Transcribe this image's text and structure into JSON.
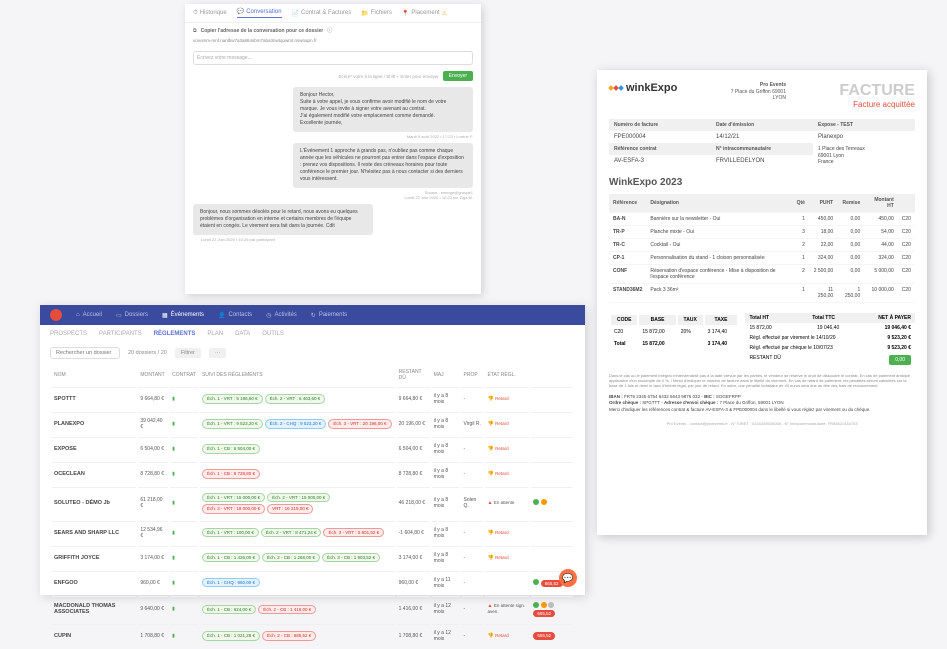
{
  "conversation": {
    "tabs": {
      "historique": "Historique",
      "conversation": "Conversation",
      "contrat": "Contrat & Factures",
      "fichiers": "Fichiers",
      "placement": "Placement"
    },
    "copy_label": "Copier l'adresse de la conversation pour ce dossier",
    "email_addr": "xovomm-mnf.nanlbw7a3a864sbm7aba3nwtqowmt.nswnapn.fr",
    "input_placeholder": "Écrivez votre message...",
    "send_meta": "Ecrire* votre à la ligne / Shift + Enter pour envoyer",
    "send_btn": "Envoyer",
    "msg1": {
      "greeting": "Bonjour Hector,",
      "l1": "Suite à votre appel, je vous confirme avoir modifié le nom de votre marque. Je vous invite à signer votre avenant au contrat.",
      "l2": "J'ai également modifié votre emplacement comme demandé.",
      "l3": "Excellente journée,",
      "meta": "Mardi 9 août 2022 • 17:23 • Lorène F."
    },
    "msg2": {
      "l1": "L'Événement 1 approche à grands pas, n'oubliez pas comme chaque année que les véhicules ne pourront pas entrer dans l'espace d'exposition : prenez vos dispositions. Il reste des créneaux horaires pour toute conférence le premier jour. N'hésitez pas à nous contacter si des derniers vous intéressent.",
      "meta_src": "Source : emerge@groupe1",
      "meta_date": "Lundi 22 Juin 2020 • 10:23 sur Ziga M."
    },
    "msg3": {
      "l1": "Bonjour, nous sommes désolés pour le retard, nous avons eu quelques problèmes d'organisation en interne et certains membres de l'équipe étaient en congés. Le virement sera fait dans la journée. Cdlt",
      "meta": "Lundi 22 Juin 2020 • 10:25 par participant"
    }
  },
  "invoice": {
    "brand": "winkExpo",
    "company": "Pro Events",
    "addr1": "7 Place du Griffon 69001",
    "addr2": "LYON",
    "title": "FACTURE",
    "status": "Facture acquittée",
    "labels": {
      "num": "Numéro de facture",
      "date": "Date d'émission",
      "expose": "Expose - TEST",
      "ref": "Référence contrat",
      "intra": "N° intracommunautaire"
    },
    "vals": {
      "num": "FPE000004",
      "date": "14/12/21",
      "client": "Planexpo",
      "client_addr1": "1 Place des Terreaux",
      "client_addr2": "69001 Lyon",
      "client_addr3": "France",
      "ref": "AV-ESFA-3",
      "intra": "FRVILLEDELYON"
    },
    "event_title": "WinkExpo 2023",
    "cols": {
      "ref": "Référence",
      "des": "Désignation",
      "qte": "Qté",
      "puht": "PUHT",
      "rem": "Remise",
      "mht": "Montant HT"
    },
    "lines": [
      {
        "ref": "BA-N",
        "des": "Bannière sur la newsletter - Oui",
        "qte": "1",
        "puht": "450,00",
        "rem": "0,00",
        "mht": "450,00",
        "tva": "C20"
      },
      {
        "ref": "TR-P",
        "des": "Planche mixte - Oui",
        "qte": "3",
        "puht": "18,00",
        "rem": "0,00",
        "mht": "54,00",
        "tva": "C20"
      },
      {
        "ref": "TR-C",
        "des": "Cocktail - Oui",
        "qte": "2",
        "puht": "22,00",
        "rem": "0,00",
        "mht": "44,00",
        "tva": "C20"
      },
      {
        "ref": "CP-1",
        "des": "Personnalisation du stand - 1 cloison personnalisée",
        "qte": "1",
        "puht": "324,00",
        "rem": "0,00",
        "mht": "324,00",
        "tva": "C20"
      },
      {
        "ref": "CONF",
        "des": "Réservation d'espace conférence - Mise à disposition de l'espace conférence",
        "qte": "2",
        "puht": "2 500,00",
        "rem": "0,00",
        "mht": "5 000,00",
        "tva": "C20"
      },
      {
        "ref": "STAND36M2",
        "des": "Pack 3 36m²",
        "qte": "1",
        "puht": "11 250,00",
        "rem": "1 250,00",
        "mht": "10 000,00",
        "tva": "C20"
      }
    ],
    "tax": {
      "h_code": "CODE",
      "h_base": "BASE",
      "h_taux": "TAUX",
      "h_taxe": "TAXE",
      "code": "C20",
      "base": "15 872,00",
      "taux": "20%",
      "taxe": "3 174,40",
      "tot_label": "Total",
      "tot_base": "15 872,00",
      "tot_taxe": "3 174,40"
    },
    "sum": {
      "h_ht": "Total HT",
      "h_ttc": "Total TTC",
      "h_net": "NET À PAYER",
      "ht": "15 872,00",
      "ttc": "19 046,40",
      "net": "19 046,40 €",
      "reg1_lbl": "Règl. effectué par virement le 14/10/20",
      "reg1_v": "9 523,20 €",
      "reg2_lbl": "Règl. effectué par chèque le 10/07/23",
      "reg2_v": "9 523,20 €",
      "rest_lbl": "RESTANT DÛ",
      "rest_v": "0,00"
    },
    "fine_print": "Dans le cas où le paiement intégral n'interviendrait pas à la date prévue par les parties, le vendeur se réserve le droit de dissoudre le contrat. En cas de paiement anticipé application d'un escompte de 0 %. / Merci d'indiquer le numéro de facture dans le libellé du virement. En cas de retard de paiement, les pénalités seront calculées sur la base de 1 fois et demi le taux d'intérêt légal, par jour de retard. En outre, une pénalité forfaitaire de 40 euros sera due au titre des frais de recouvrement.",
    "iban_l1_label": "IBAN : ",
    "iban_l1": "FR76 2345 6754 6432 5643 9876 032 - ",
    "bic_label": "BIC : ",
    "bic": "SOGEFRPP",
    "iban_l2_label": "Ordre chèque : ",
    "iban_l2": "SPGTTT - ",
    "addr_label": "Adresse d'envoi chèque : ",
    "addr_v": "7 Place du Griffon, 69001 LYON",
    "iban_l3_a": "Merci d'indiquer les références contrat & facture ",
    "iban_l3_b": "AV-ESFA-3 & FPE000004 dans le libellé",
    "iban_l3_c": " si vous réglez par virement ou du chèque.",
    "footer": "Pro Events - contact@proevents.fr - N° SIRET : 0216345930008 - N° intracommunautaire: FR83821434703"
  },
  "reglements": {
    "nav": {
      "accueil": "Accueil",
      "dossiers": "Dossiers",
      "evenements": "Événements",
      "contacts": "Contacts",
      "activites": "Activités",
      "paiements": "Paiements"
    },
    "subtabs": {
      "prospects": "PROSPECTS",
      "participants": "PARTICIPANTS",
      "reglements": "RÈGLEMENTS",
      "plan": "PLAN",
      "data": "DATA",
      "outils": "OUTILS"
    },
    "search_ph": "Rechercher un dossier",
    "count": "20 dossiers / 20",
    "filter_btn": "Filtrer",
    "more": "···",
    "cols": {
      "nom": "NOM",
      "montant": "MONTANT",
      "contrat": "CONTRAT",
      "suivi": "SUIVI DES RÈGLEMENTS",
      "restant": "RESTANT DÛ",
      "maj": "MAJ",
      "prop": "PROP",
      "etat": "ÉTAT RÈGL."
    },
    "rows": [
      {
        "name": "SPOTTT",
        "montant": "9 664,80 €",
        "pills": [
          {
            "t": "Éch. 1 - VRT : 5 196,60 €",
            "c": "green"
          },
          {
            "t": "Éch. 2 - VRT : 6 463,60 €",
            "c": "green"
          }
        ],
        "restant": "9 664,80 €",
        "maj": "il y a 8 mois",
        "prop": "-",
        "etat": "Retard"
      },
      {
        "name": "PLANEXPO",
        "montant": "39 042,40 €",
        "pills": [
          {
            "t": "Éch. 1 - VRT : 9 523,20 €",
            "c": "green"
          },
          {
            "t": "Éch. 2 - CHQ : 9 523,20 €",
            "c": "blue"
          },
          {
            "t": "Éch. 3 - VRT : 20 196,00 €",
            "c": "red"
          }
        ],
        "restant": "20 196,00 €",
        "maj": "il y a 8 mois",
        "prop": "Virgil R.",
        "etat": "Retard"
      },
      {
        "name": "EXPOSE",
        "montant": "6 504,00 €",
        "pills": [
          {
            "t": "Éch. 1 - CB : 6 504,00 €",
            "c": "green"
          }
        ],
        "restant": "6 504,00 €",
        "maj": "il y a 8 mois",
        "prop": "-",
        "etat": "Retard"
      },
      {
        "name": "OCECLEAN",
        "montant": "8 728,80 €",
        "pills": [
          {
            "t": "Éch. 1 - CB : 8 728,80 €",
            "c": "red"
          }
        ],
        "restant": "8 728,80 €",
        "maj": "il y a 8 mois",
        "prop": "-",
        "etat": "Retard"
      },
      {
        "name": "SOLUTEO - DÉMO Jb",
        "montant": "61 218,00 €",
        "pills": [
          {
            "t": "Éch. 1 - VRT : 15 000,00 €",
            "c": "green"
          },
          {
            "t": "Éch. 2 - VRT : 15 000,00 €",
            "c": "green"
          },
          {
            "t": "Éch. 3 - VRT : 18 000,00 €",
            "c": "red"
          },
          {
            "t": "VRT : 16 219,00 €",
            "c": "red"
          }
        ],
        "restant": "46 218,00 €",
        "maj": "il y a 8 mois",
        "prop": "Solen Q.",
        "etat": "En attente",
        "dots": "go"
      },
      {
        "name": "SEARS AND SHARP LLC",
        "montant": "12 534,96 €",
        "pills": [
          {
            "t": "Éch. 1 - VRT : 100,00 €",
            "c": "green"
          },
          {
            "t": "Éch. 2 - VRT : 8 471,24 €",
            "c": "green"
          },
          {
            "t": "Éch. 3 - VRT : 5 601,52 €",
            "c": "red"
          }
        ],
        "restant": "-1 604,80 €",
        "maj": "il y a 8 mois",
        "prop": "-",
        "etat": "Retard"
      },
      {
        "name": "GRIFFITH JOYCE",
        "montant": "3 174,00 €",
        "pills": [
          {
            "t": "Éch. 1 - CB : 1 426,00 €",
            "c": "green"
          },
          {
            "t": "Éch. 2 - CB : 1 268,00 €",
            "c": "green"
          },
          {
            "t": "Éch. 3 - CB : 1 903,52 €",
            "c": "green"
          }
        ],
        "restant": "3 174,00 €",
        "maj": "il y a 8 mois",
        "prop": "-",
        "etat": "Retard"
      },
      {
        "name": "ENFGOO",
        "montant": "960,00 €",
        "pills": [
          {
            "t": "Éch. 1 - CHQ : 960,00 €",
            "c": "blue"
          }
        ],
        "restant": "960,00 €",
        "maj": "il y a 11 mois",
        "prop": "-",
        "etat": "",
        "dots": "g",
        "badge": "665,52"
      },
      {
        "name": "MACDONALD THOMAS ASSOCIATES",
        "montant": "9 640,00 €",
        "pills": [
          {
            "t": "Éch. 1 - CB : 624,00 €",
            "c": "green"
          },
          {
            "t": "Éch. 2 - CB : 1 416,00 €",
            "c": "red"
          }
        ],
        "restant": "1 416,00 €",
        "maj": "il y a 12 mois",
        "prop": "-",
        "etat": "En attente sign. aven.",
        "dots": "ogr",
        "badge": "665,52"
      },
      {
        "name": "CUPIN",
        "montant": "1 708,80 €",
        "pills": [
          {
            "t": "Éch. 1 - CB : 1 021,28 €",
            "c": "green"
          },
          {
            "t": "Éch. 2 - CB : 685,52 €",
            "c": "red"
          }
        ],
        "restant": "1 708,80 €",
        "maj": "il y a 12 mois",
        "prop": "-",
        "etat": "Retard",
        "badge": "665,52"
      }
    ]
  }
}
